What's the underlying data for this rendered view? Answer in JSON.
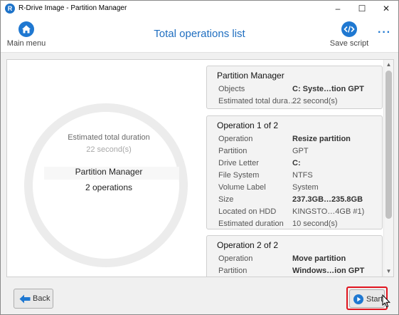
{
  "window": {
    "title": "R-Drive Image - Partition Manager",
    "app_icon_letter": "R",
    "minimize": "–",
    "maximize": "☐",
    "close": "✕"
  },
  "toolbar": {
    "main_menu_label": "Main menu",
    "title": "Total operations list",
    "save_script_label": "Save script",
    "more": "···"
  },
  "summary": {
    "estimated_label": "Estimated total duration",
    "estimated_value": "22 second(s)",
    "title": "Partition Manager",
    "operations": "2 operations"
  },
  "cards": [
    {
      "title": "Partition Manager",
      "rows": [
        {
          "key": "Objects",
          "value": "C: Syste…tion GPT",
          "bold": true
        },
        {
          "key": "Estimated total dura…",
          "value": "22 second(s)",
          "bold": false
        }
      ]
    },
    {
      "title": "Operation 1 of 2",
      "rows": [
        {
          "key": "Operation",
          "value": "Resize partition",
          "bold": true
        },
        {
          "key": "Partition",
          "value": "GPT",
          "bold": false
        },
        {
          "key": "Drive Letter",
          "value": "C:",
          "bold": true
        },
        {
          "key": "File System",
          "value": "NTFS",
          "bold": false
        },
        {
          "key": "Volume Label",
          "value": "System",
          "bold": false
        },
        {
          "key": "Size",
          "value": "237.3GB…235.8GB",
          "bold": true
        },
        {
          "key": "Located on HDD",
          "value": "KINGSTO…4GB #1)",
          "bold": false
        },
        {
          "key": "Estimated duration",
          "value": "10 second(s)",
          "bold": false
        }
      ]
    },
    {
      "title": "Operation 2 of 2",
      "rows": [
        {
          "key": "Operation",
          "value": "Move partition",
          "bold": true
        },
        {
          "key": "Partition",
          "value": "Windows…ion GPT",
          "bold": true
        }
      ]
    }
  ],
  "buttons": {
    "back": "Back",
    "start": "Start"
  },
  "colors": {
    "accent": "#1f78d1",
    "title_blue": "#1f6ec0",
    "highlight": "#e0141e"
  },
  "icons": {
    "main_menu": "home-icon",
    "save_script": "code-icon",
    "back": "arrow-left-icon",
    "start": "play-icon"
  }
}
